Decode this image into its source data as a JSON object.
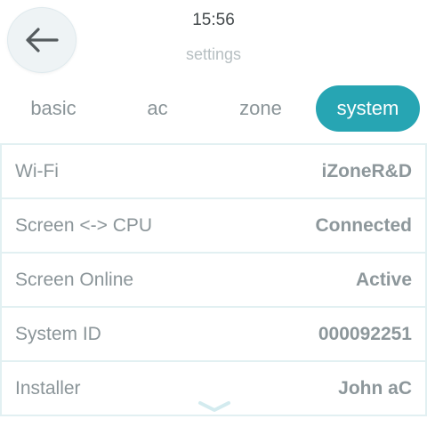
{
  "header": {
    "time": "15:56",
    "subtitle": "settings",
    "back_icon": "arrow-left-icon"
  },
  "tabs": [
    {
      "label": "basic",
      "active": false
    },
    {
      "label": "ac",
      "active": false
    },
    {
      "label": "zone",
      "active": false
    },
    {
      "label": "system",
      "active": true
    }
  ],
  "settings": [
    {
      "label": "Wi-Fi",
      "value": "iZoneR&D"
    },
    {
      "label": "Screen <-> CPU",
      "value": "Connected"
    },
    {
      "label": "Screen Online",
      "value": "Active"
    },
    {
      "label": "System ID",
      "value": "000092251"
    },
    {
      "label": "Installer",
      "value": "John aC"
    }
  ],
  "colors": {
    "accent": "#27a5b3",
    "text_muted": "#8b9599",
    "divider": "#e2f0f2"
  },
  "scroll_indicator_icon": "chevron-down-icon"
}
